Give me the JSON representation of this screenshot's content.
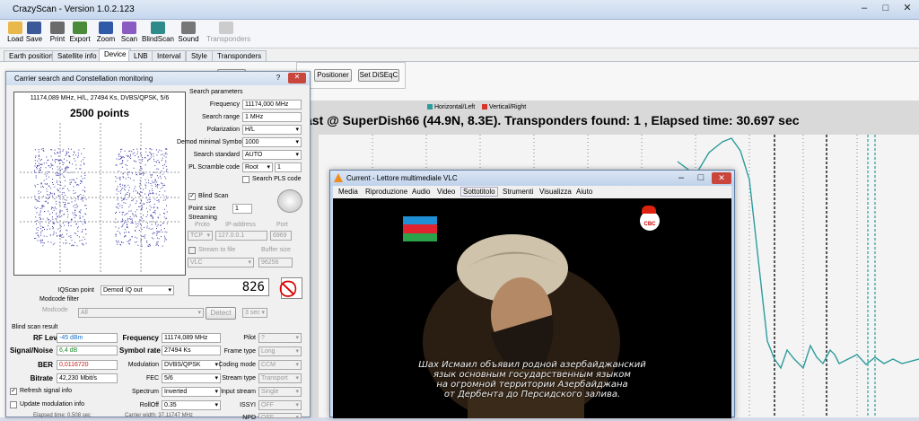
{
  "app": {
    "title": "CrazyScan - Version 1.0.2.123"
  },
  "toolbar": [
    {
      "label": "Load",
      "icon": "folder-icon",
      "color": "#3a7bd5"
    },
    {
      "label": "Save",
      "icon": "floppy-icon",
      "color": "#3b5998"
    },
    {
      "label": "Print",
      "icon": "printer-icon",
      "color": "#6b6b6b"
    },
    {
      "label": "Export",
      "icon": "export-icon",
      "color": "#4a8b3a"
    },
    {
      "label": "Zoom",
      "icon": "magnifier-icon",
      "color": "#2f5aa8"
    },
    {
      "label": "Scan",
      "icon": "scan-icon",
      "color": "#8a5cc2"
    },
    {
      "label": "BlindScan",
      "icon": "satellite-dish-icon",
      "color": "#2f8a8a"
    },
    {
      "label": "Sound",
      "icon": "speaker-icon",
      "color": "#777777"
    },
    {
      "label": "Transponders",
      "icon": "transponder-icon",
      "color": "#bbbbbb"
    }
  ],
  "tabs": [
    "Earth position",
    "Satellite info",
    "Device",
    "LNB",
    "Interval",
    "Style",
    "Transponders"
  ],
  "device_buttons": {
    "positioner": "Positioner",
    "diseqc": "Set DiSEqC"
  },
  "chart": {
    "legend": [
      {
        "label": "Horizontal/Left",
        "color": "#2e9c9c"
      },
      {
        "label": "Vertical/Right",
        "color": "#d9342b"
      }
    ],
    "title": "ast @ SuperDish66 (44.9N, 8.3E). Transponders found: 1 , Elapsed time: 30.697 sec"
  },
  "carrier": {
    "title": "Carrier search and Constellation monitoring",
    "constellation_header": "11174,089 MHz, H/L, 27494 Ks, DVBS/QPSK, 5/6",
    "points": "2500 points",
    "search_params_label": "Search parameters",
    "frequency_label": "Frequency",
    "frequency": "11174,000 MHz",
    "search_range_label": "Search range",
    "search_range": "1 MHz",
    "polarization_label": "Polarization",
    "polarization": "H/L",
    "min_sr_label": "Demod minimal Symbol rate",
    "min_sr": "1000",
    "standard_label": "Search standard",
    "standard": "AUTO",
    "pls_label": "PL Scramble code",
    "pls_mode": "Root",
    "pls_value": "1",
    "search_pls": "Search PLS code",
    "blind_scan": "Blind Scan",
    "point_size_label": "Point size",
    "point_size": "1",
    "streaming_label": "Streaming",
    "proto_h": "Proto",
    "ip_h": "IP-address",
    "port_h": "Port",
    "proto": "TCP",
    "ip": "127.0.0.1",
    "port": "6969",
    "stream_to_file": "Stream to file",
    "buffer_size_label": "Buffer size",
    "player": "VLC",
    "buffer_size": "96256",
    "counter": "826",
    "iqscan_label": "IQScan point",
    "iqscan": "Demod IQ out",
    "modcode_filter": "Modcode filter",
    "modcode_label": "Modcode",
    "modcode": "All",
    "detect": "Detect",
    "detect_time": "3 sec",
    "result_label": "Blind scan result",
    "rf_label": "RF Level",
    "rf": "-45 dBm",
    "sn_label": "Signal/Noise",
    "sn": "6,4 dB",
    "ber_label": "BER",
    "ber": "0,0116720",
    "bitrate_label": "Bitrate",
    "bitrate": "42,230 Mbit/s",
    "r_freq_label": "Frequency",
    "r_freq": "11174,089 MHz",
    "r_sr_label": "Symbol rate",
    "r_sr": "27494 Ks",
    "mod_label": "Modulation",
    "mod": "DVBS/QPSK",
    "fec_label": "FEC",
    "fec": "5/6",
    "spectrum_label": "Spectrum",
    "spectrum": "Inverted",
    "rolloff_label": "RollOff",
    "rolloff": "0.35",
    "pilot_label": "Pilot",
    "pilot": "?",
    "frame_label": "Frame type",
    "frame": "Long",
    "coding_label": "Coding mode",
    "coding": "CCM",
    "stype_label": "Stream type",
    "stype": "Transport",
    "input_label": "Input stream",
    "input": "Single",
    "issyi_label": "ISSYI",
    "issyi": "OFF",
    "npd_label": "NPD",
    "npd": "OFF",
    "refresh": "Refresh signal info",
    "update_mod": "Update modulation info",
    "elapsed": "Elapsed time: 0.508 sec",
    "carrier_width": "Carrier width: 37,11747 MHz"
  },
  "vlc": {
    "title": "Current - Lettore multimediale VLC",
    "menu": [
      "Media",
      "Riproduzione",
      "Audio",
      "Video",
      "Sottotitolo",
      "Strumenti",
      "Visualizza",
      "Aiuto"
    ],
    "logo": "CBC",
    "subtitle": [
      "Шах Исмаил объявил родной азербайджанский",
      "язык основным государственным языком",
      "на огромной территории Азербайджана",
      "от Дербента до Персидского залива."
    ]
  }
}
